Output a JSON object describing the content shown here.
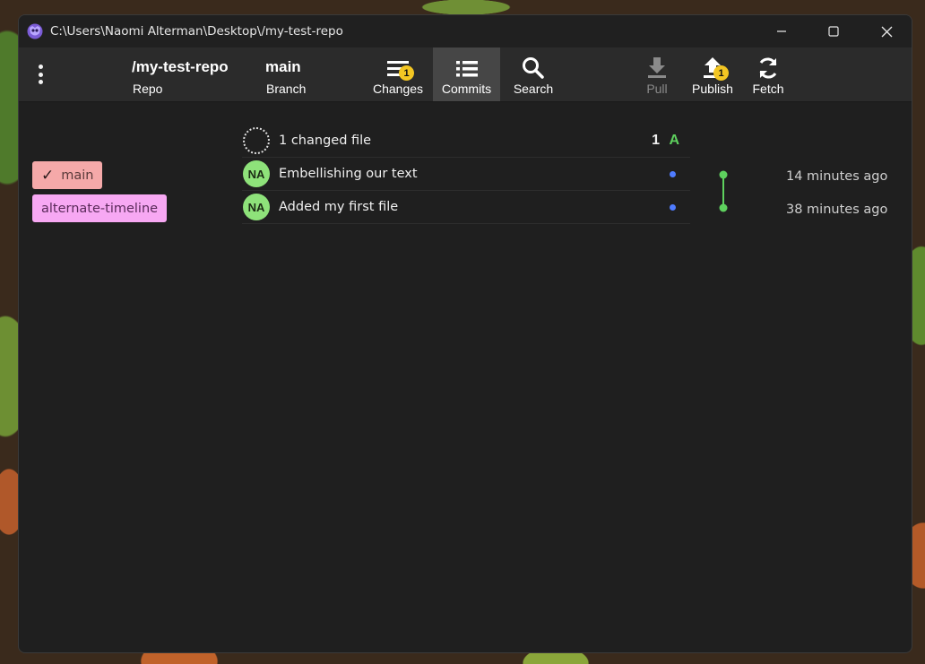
{
  "window": {
    "title": "C:\\Users\\Naomi Alterman\\Desktop\\/my-test-repo"
  },
  "toolbar": {
    "repo_title": "/my-test-repo",
    "repo_sub": "Repo",
    "branch_title": "main",
    "branch_sub": "Branch",
    "buttons": [
      {
        "label": "Changes",
        "icon": "changes-icon",
        "badge": "1",
        "active": false,
        "enabled": true
      },
      {
        "label": "Commits",
        "icon": "list-icon",
        "badge": "",
        "active": true,
        "enabled": true
      },
      {
        "label": "Search",
        "icon": "search-icon",
        "badge": "",
        "active": false,
        "enabled": true
      },
      {
        "label": "Pull",
        "icon": "download-icon",
        "badge": "",
        "active": false,
        "enabled": false
      },
      {
        "label": "Publish",
        "icon": "upload-icon",
        "badge": "1",
        "active": false,
        "enabled": true
      },
      {
        "label": "Fetch",
        "icon": "refresh-icon",
        "badge": "",
        "active": false,
        "enabled": true
      }
    ]
  },
  "branches": [
    {
      "label": "main",
      "checked": true,
      "check_mark": "✓",
      "color": "#f5a9a9"
    },
    {
      "label": "alternate-timeline",
      "checked": false,
      "color": "#f7a8f3"
    }
  ],
  "changes_row": {
    "text": "1 changed file",
    "count": "1",
    "status": "A",
    "status_color": "#5ed15e"
  },
  "commits": [
    {
      "initials": "NA",
      "message": "Embellishing our text",
      "time": "14 minutes ago"
    },
    {
      "initials": "NA",
      "message": "Added my first file",
      "time": "38 minutes ago"
    }
  ],
  "colors": {
    "avatar": "#8ee27a",
    "graph": "#5ed15e",
    "unpushed_dot": "#4f7cff",
    "badge": "#f3c623"
  }
}
